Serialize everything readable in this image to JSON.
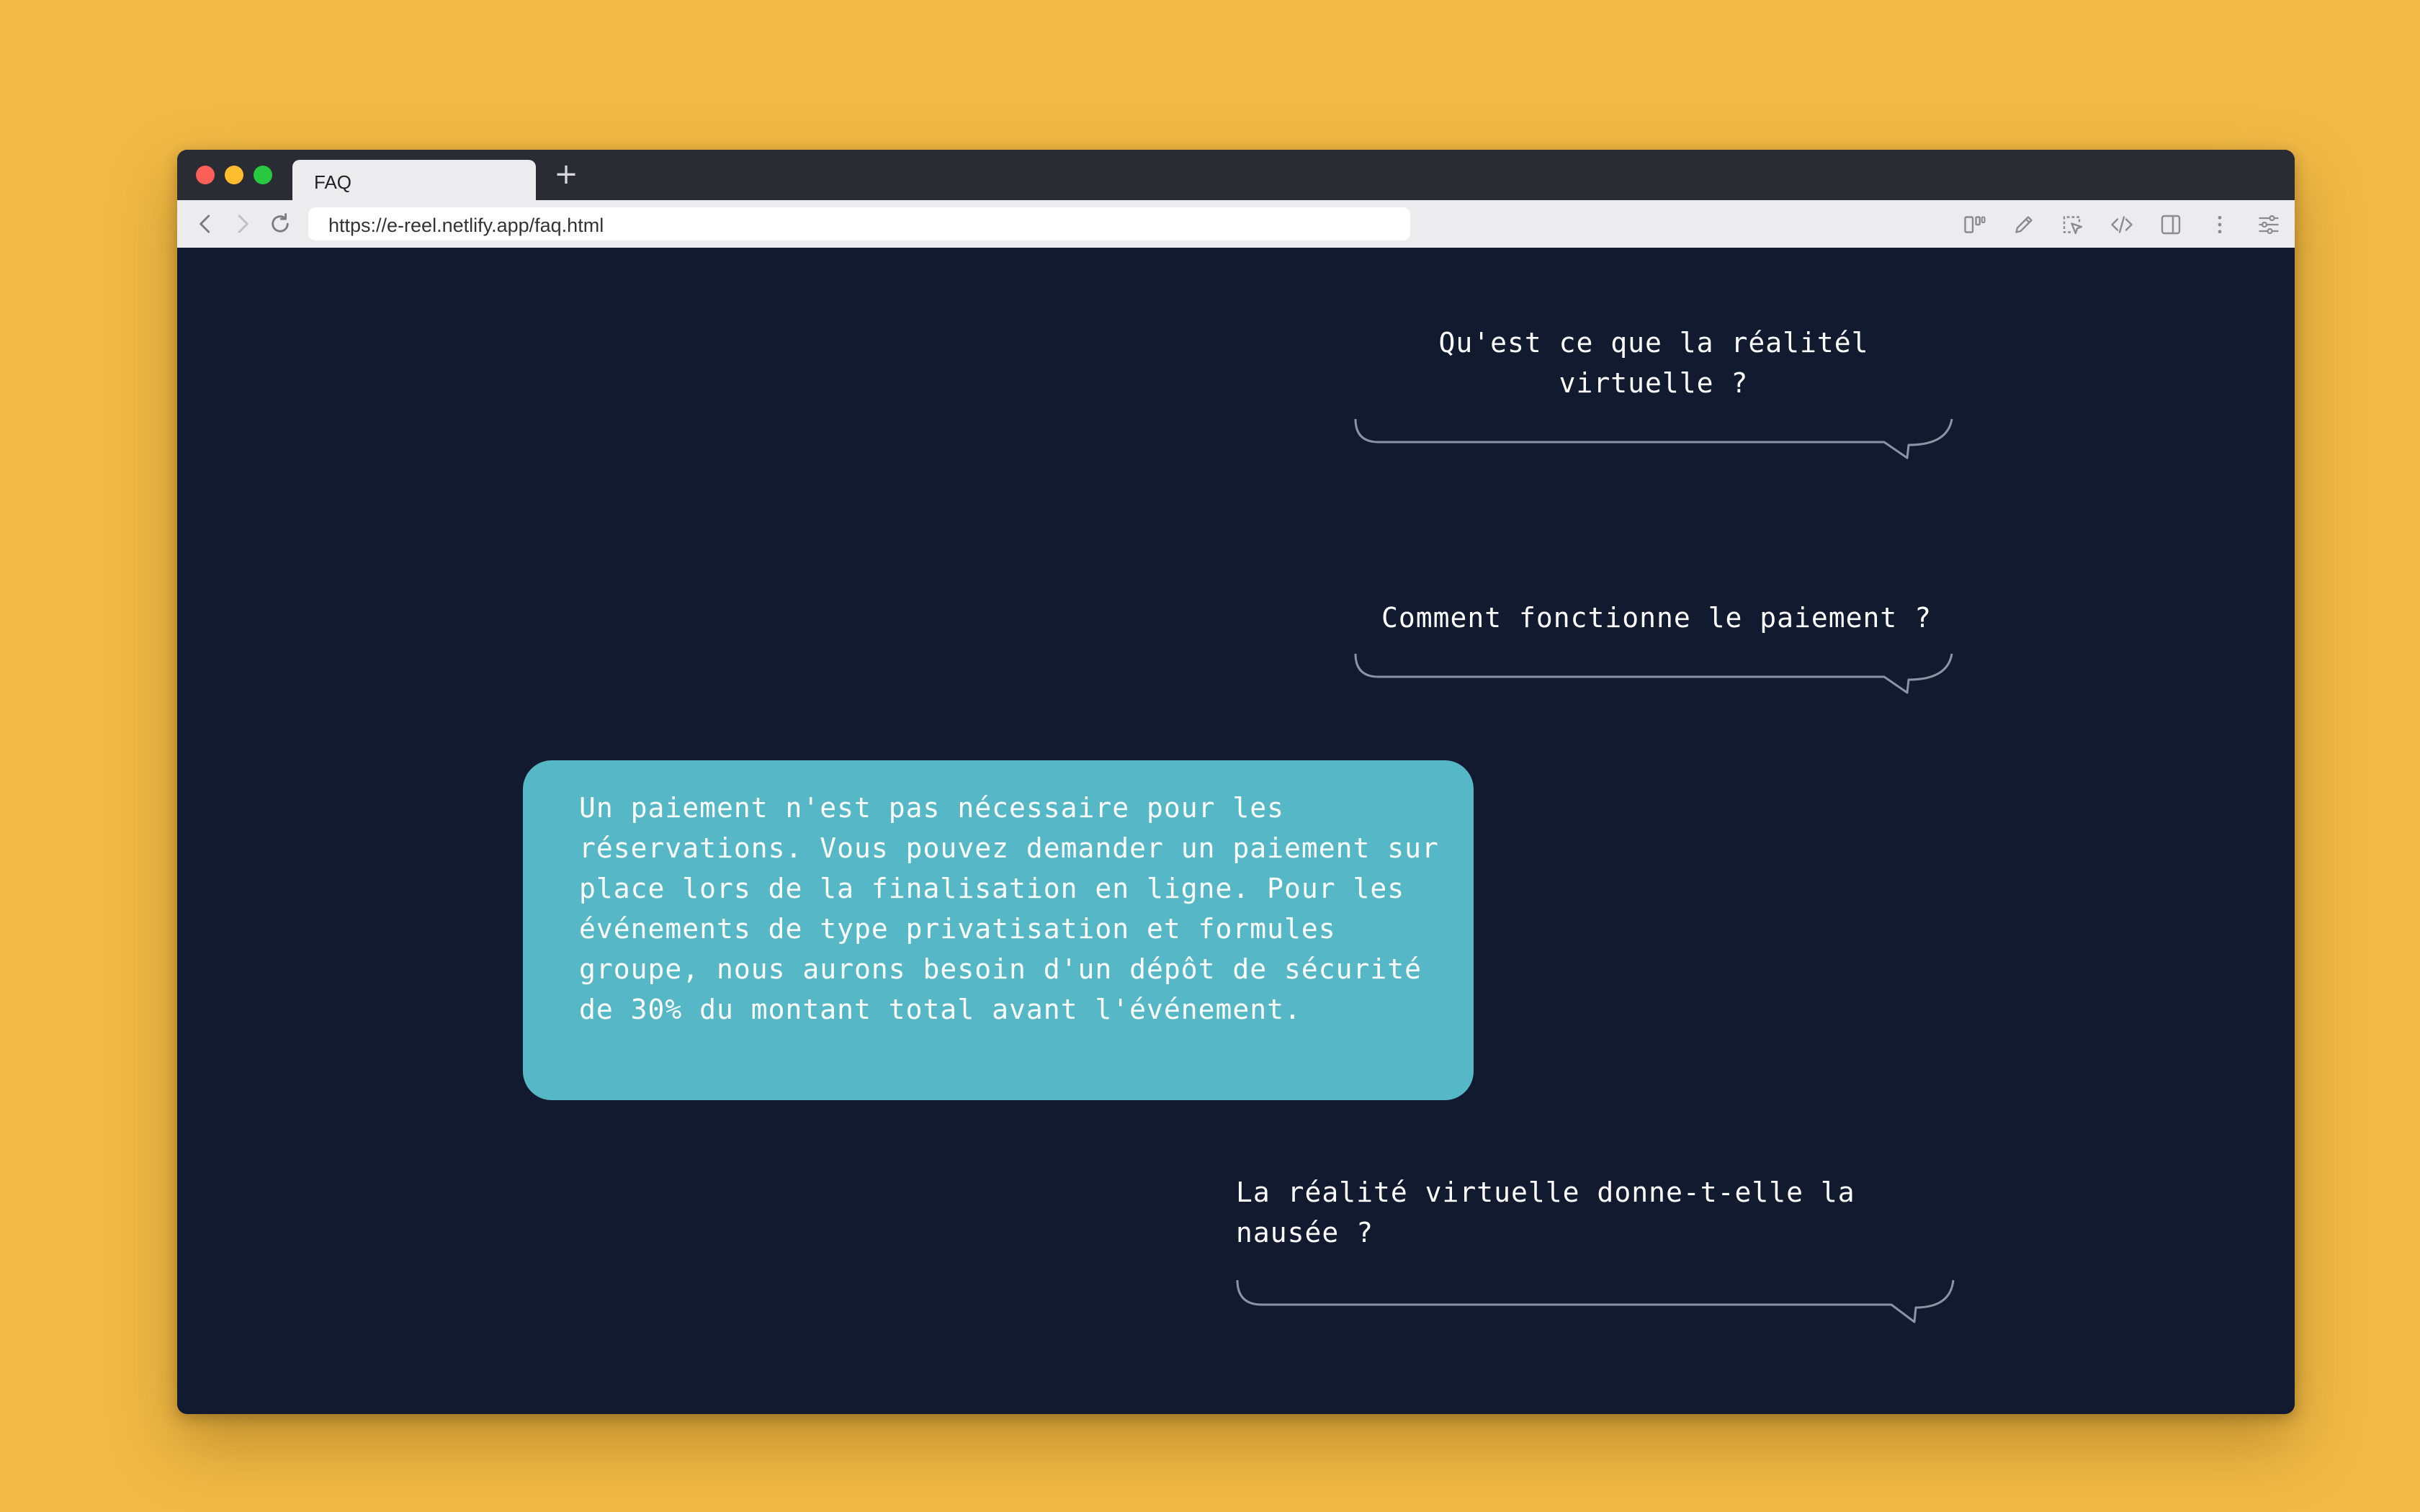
{
  "browser": {
    "tab_title": "FAQ",
    "new_tab_symbol": "+",
    "url": "https://e-reel.netlify.app/faq.html",
    "toolbar_icons": [
      "back-icon",
      "forward-icon",
      "reload-icon",
      "reader-view-icon",
      "pen-icon",
      "element-picker-icon",
      "code-icon",
      "sidebar-icon",
      "more-icon",
      "settings-sliders-icon"
    ]
  },
  "faq": {
    "questions": [
      "Qu'est ce que la réalitél virtuelle ?",
      "Comment fonctionne le paiement ?",
      "La réalité virtuelle donne-t-elle la nausée ?"
    ],
    "answer": "Un paiement n'est pas nécessaire pour les réservations. Vous pouvez demander un paiement sur place lors de la finalisation en ligne. Pour les événements de type privatisation et formules groupe, nous aurons besoin d'un dépôt de sécurité de 30% du montant total avant l'événement."
  },
  "colors": {
    "page_background": "#F2BA45",
    "content_background": "#121A2F",
    "answer_bubble": "#56B8C6",
    "text": "#FFFFFF"
  }
}
